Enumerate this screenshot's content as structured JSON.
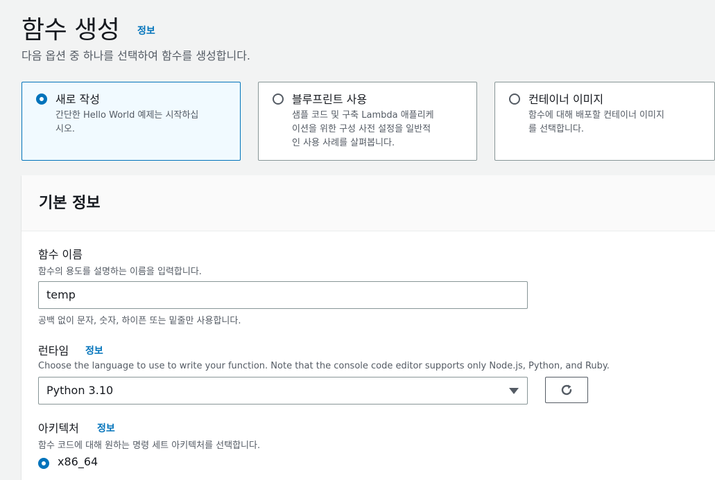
{
  "header": {
    "title": "함수 생성",
    "info_link": "정보",
    "description": "다음 옵션 중 하나를 선택하여 함수를 생성합니다."
  },
  "options": [
    {
      "title": "새로 작성",
      "description": "간단한 Hello World 예제는 시작하십시오.",
      "desc_lines": [
        "간단한 Hello World 예제는 시작하십",
        "시오."
      ],
      "selected": true
    },
    {
      "title": "블루프린트 사용",
      "description": "샘플 코드 및 구축 Lambda 애플리케이션을 위한 구성 사전 설정을 일반적인 사용 사례를 살펴봅니다.",
      "desc_lines": [
        "샘플 코드 및 구축 Lambda 애플리케",
        "이션을 위한 구성 사전 설정을 일반적",
        "인 사용 사례를 살펴봅니다."
      ],
      "selected": false
    },
    {
      "title": "컨테이너 이미지",
      "description": "함수에 대해 배포할 컨테이너 이미지를 선택합니다.",
      "desc_lines": [
        "함수에 대해 배포할 컨테이너 이미지",
        "를 선택합니다."
      ],
      "selected": false
    }
  ],
  "basic_info": {
    "title": "기본 정보",
    "function_name": {
      "label": "함수 이름",
      "description": "함수의 용도를 설명하는 이름을 입력합니다.",
      "value": "temp",
      "constraint": "공백 없이 문자, 숫자, 하이픈 또는 밑줄만 사용합니다."
    },
    "runtime": {
      "label": "런타임",
      "info_link": "정보",
      "description": "Choose the language to use to write your function. Note that the console code editor supports only Node.js, Python, and Ruby.",
      "selected": "Python 3.10",
      "refresh_icon": "refresh-icon"
    },
    "architecture": {
      "label": "아키텍처",
      "info_link": "정보",
      "description": "함수 코드에 대해 원하는 명령 세트 아키텍처를 선택합니다.",
      "options": [
        {
          "label": "x86_64",
          "selected": true
        }
      ]
    }
  },
  "colors": {
    "accent": "#0073bb",
    "selected_card_bg": "#f1faff",
    "page_bg": "#f2f3f3"
  }
}
